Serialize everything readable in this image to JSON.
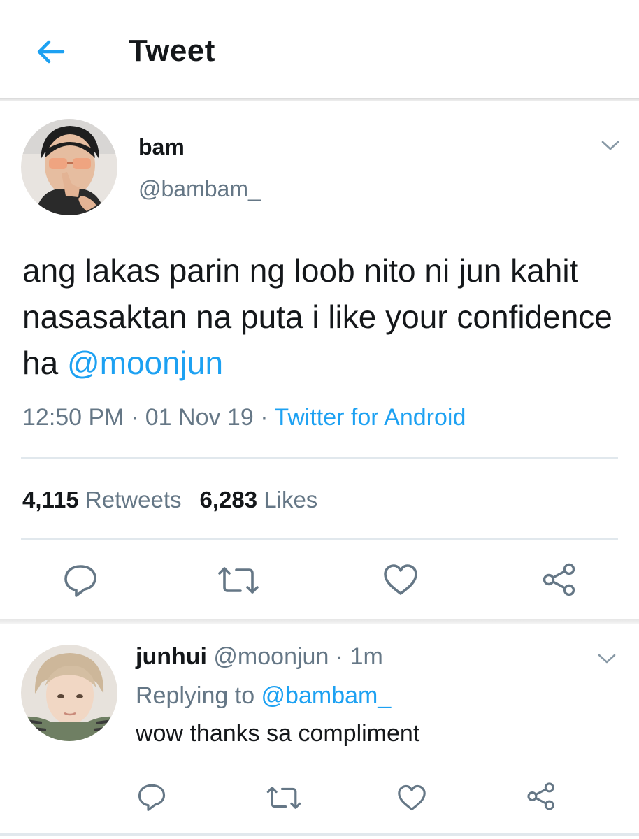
{
  "header": {
    "title": "Tweet"
  },
  "tweet": {
    "display_name": "bam",
    "handle": "@bambam_",
    "text_before": "ang lakas parin ng loob nito ni jun kahit nasasaktan na puta i like your confidence ha ",
    "mention": "@moonjun",
    "time": "12:50 PM",
    "dot": " · ",
    "date": "01 Nov 19",
    "source": "Twitter for Android",
    "retweets_count": "4,115",
    "retweets_label": " Retweets",
    "likes_count": "6,283",
    "likes_label": " Likes"
  },
  "reply": {
    "display_name": "junhui",
    "handle": " @moonjun",
    "time": " · 1m",
    "replying_to_label": "Replying to ",
    "replying_to_handle": "@bambam_",
    "text": "wow thanks sa compliment"
  },
  "icons": {
    "back": "arrow-left-icon",
    "options": "chevron-down-icon",
    "reply": "comment-icon",
    "retweet": "retweet-icon",
    "like": "heart-icon",
    "share": "share-icon"
  },
  "colors": {
    "accent": "#1da1f2",
    "secondary_text": "#657786",
    "primary_text": "#14171a",
    "divider": "#e1e8ed"
  }
}
